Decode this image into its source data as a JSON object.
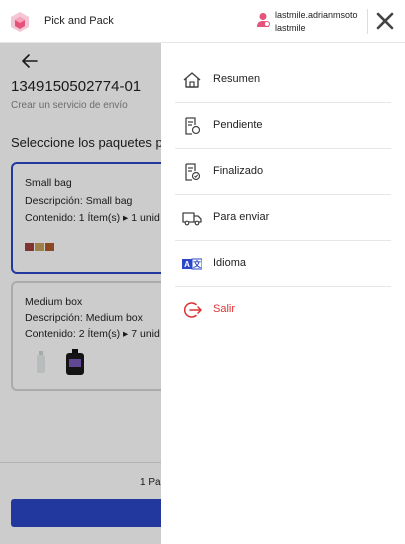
{
  "header": {
    "app_title": "Pick and Pack",
    "user_name": "lastmile.adrianmsoto",
    "user_org": "lastmile"
  },
  "page": {
    "order_id": "1349150502774-01",
    "subtitle": "Crear un servicio de envío",
    "section_title": "Seleccione los paquetes pa",
    "packages": [
      {
        "name": "Small bag",
        "description": "Descripción: Small bag",
        "content": "Contenido: 1 Ítem(s) ▸ 1 unid"
      },
      {
        "name": "Medium box",
        "description": "Descripción: Medium box",
        "content": "Contenido: 2 Ítem(s) ▸ 7 unid"
      }
    ],
    "footer_count": "1 Pa"
  },
  "drawer": {
    "items": [
      {
        "label": "Resumen",
        "icon": "home-icon"
      },
      {
        "label": "Pendiente",
        "icon": "pending-document-icon"
      },
      {
        "label": "Finalizado",
        "icon": "completed-document-icon"
      },
      {
        "label": "Para enviar",
        "icon": "truck-icon"
      },
      {
        "label": "Idioma",
        "icon": "translate-icon"
      },
      {
        "label": "Salir",
        "icon": "logout-icon"
      }
    ]
  },
  "colors": {
    "primary": "#2b46c7",
    "danger": "#d33333",
    "brand": "#e5527a"
  }
}
